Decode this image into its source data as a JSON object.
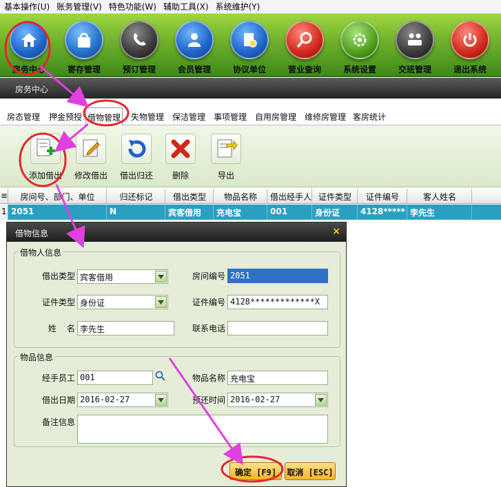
{
  "menu": [
    "基本操作(U)",
    "账务管理(V)",
    "特色功能(W)",
    "辅助工具(X)",
    "系统维护(Y)"
  ],
  "toolbar": [
    {
      "label": "房务中心",
      "icon": "home-icon",
      "color": "#1e64c8"
    },
    {
      "label": "寄存管理",
      "icon": "bag-icon",
      "color": "#2470c8"
    },
    {
      "label": "预订管理",
      "icon": "phone-icon",
      "color": "#3a3a3a"
    },
    {
      "label": "会员管理",
      "icon": "member-icon",
      "color": "#1e64c8"
    },
    {
      "label": "协议单位",
      "icon": "contract-icon",
      "color": "#1e64c8"
    },
    {
      "label": "营业查询",
      "icon": "search-icon",
      "color": "#d0281c"
    },
    {
      "label": "系统设置",
      "icon": "gear-icon",
      "color": "#4f9f1e"
    },
    {
      "label": "交班管理",
      "icon": "handover-icon",
      "color": "#3a3a3a"
    },
    {
      "label": "退出系统",
      "icon": "power-icon",
      "color": "#d0281c"
    }
  ],
  "band_title": "房务中心",
  "tabs": [
    "房态管理",
    "押金预授",
    "借物管理",
    "失物管理",
    "保洁管理",
    "事项管理",
    "自用房管理",
    "维修房管理",
    "客房统计"
  ],
  "active_tab": "借物管理",
  "subtoolbar": [
    {
      "label": "添加借出",
      "icon": "add-document-icon"
    },
    {
      "label": "修改借出",
      "icon": "edit-document-icon"
    },
    {
      "label": "借出归还",
      "icon": "return-icon"
    },
    {
      "label": "删除",
      "icon": "delete-icon"
    },
    {
      "label": "导出",
      "icon": "export-icon"
    }
  ],
  "grid": {
    "headers": [
      "房间号、部门、单位",
      "归还标记",
      "借出类型",
      "物品名称",
      "借出经手人",
      "证件类型",
      "证件编号",
      "客人姓名"
    ],
    "rows": [
      {
        "num": "1",
        "cells": [
          "2051",
          "N",
          "宾客借用",
          "充电宝",
          "001",
          "身份证",
          "4128*****",
          "李先生"
        ]
      }
    ]
  },
  "dialog": {
    "title": "借物信息",
    "close": "×",
    "borrower": {
      "group_title": "借物人信息",
      "type_label": "借出类型",
      "type_value": "宾客借用",
      "room_label": "房间编号",
      "room_value": "2051",
      "idtype_label": "证件类型",
      "idtype_value": "身份证",
      "idno_label": "证件编号",
      "idno_value": "4128*************X",
      "name_label": "姓    名",
      "name_value": "李先生",
      "phone_label": "联系电话",
      "phone_value": ""
    },
    "item": {
      "group_title": "物品信息",
      "handler_label": "经手员工",
      "handler_value": "001",
      "itemname_label": "物品名称",
      "itemname_value": "充电宝",
      "date_label": "借出日期",
      "date_value": "2016-02-27",
      "return_label": "预还时间",
      "return_value": "2016-02-27",
      "remark_label": "备注信息",
      "remark_value": ""
    },
    "ok_label": "确定 [F9]",
    "cancel_label": "取消 [ESC]"
  },
  "colors": {
    "toolbar_green": "#6fb12c",
    "selected_row": "#2a9fc2",
    "annotation": "#e8242a",
    "arrow": "#e040e0"
  }
}
